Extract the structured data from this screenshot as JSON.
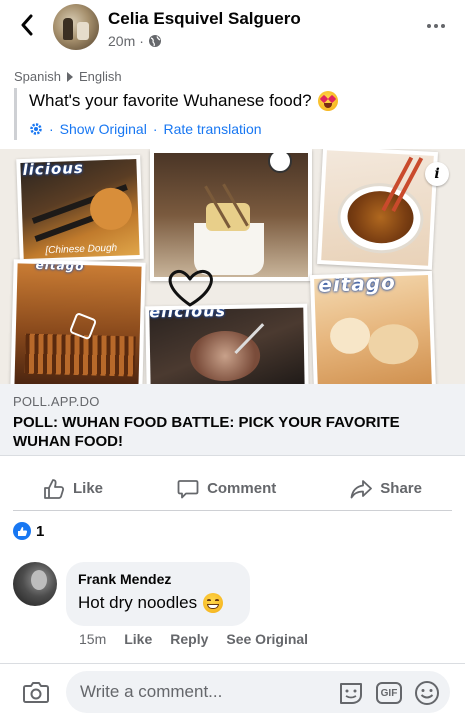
{
  "post": {
    "author": "Celia Esquivel Salguero",
    "time": "20m",
    "separator": "·",
    "text": "What's your favorite Wuhanese food?"
  },
  "translation": {
    "from_lang": "Spanish",
    "to_lang": "English",
    "show_original": "Show Original",
    "dot": "·",
    "rate": "Rate translation"
  },
  "link": {
    "domain": "POLL.APP.DO",
    "title": "POLL: WUHAN FOOD BATTLE: PICK YOUR FAVORITE WUHAN FOOD!",
    "collage_words": [
      "licious",
      "[Chinese Dough",
      "eitago",
      "elicious"
    ]
  },
  "actions": {
    "like": "Like",
    "comment": "Comment",
    "share": "Share"
  },
  "reactions": {
    "count": "1"
  },
  "comment": {
    "author": "Frank Mendez",
    "text": "Hot dry noodles",
    "time": "15m",
    "like": "Like",
    "reply": "Reply",
    "see_original": "See Original"
  },
  "composer": {
    "placeholder": "Write a comment..."
  },
  "icons": {
    "back": "chevron-left-icon",
    "globe": "globe-icon",
    "more": "more-dots-icon",
    "translate": "gear-icon",
    "info": "info-icon",
    "like": "thumbs-up-icon",
    "comment": "speech-bubble-icon",
    "share": "share-arrow-icon",
    "camera": "camera-icon",
    "sticker": "sticker-icon",
    "gif": "gif-icon",
    "emoji": "emoji-icon"
  },
  "colors": {
    "accent": "#1877f2",
    "muted_text": "#65676b",
    "bubble_bg": "#f0f2f5"
  }
}
